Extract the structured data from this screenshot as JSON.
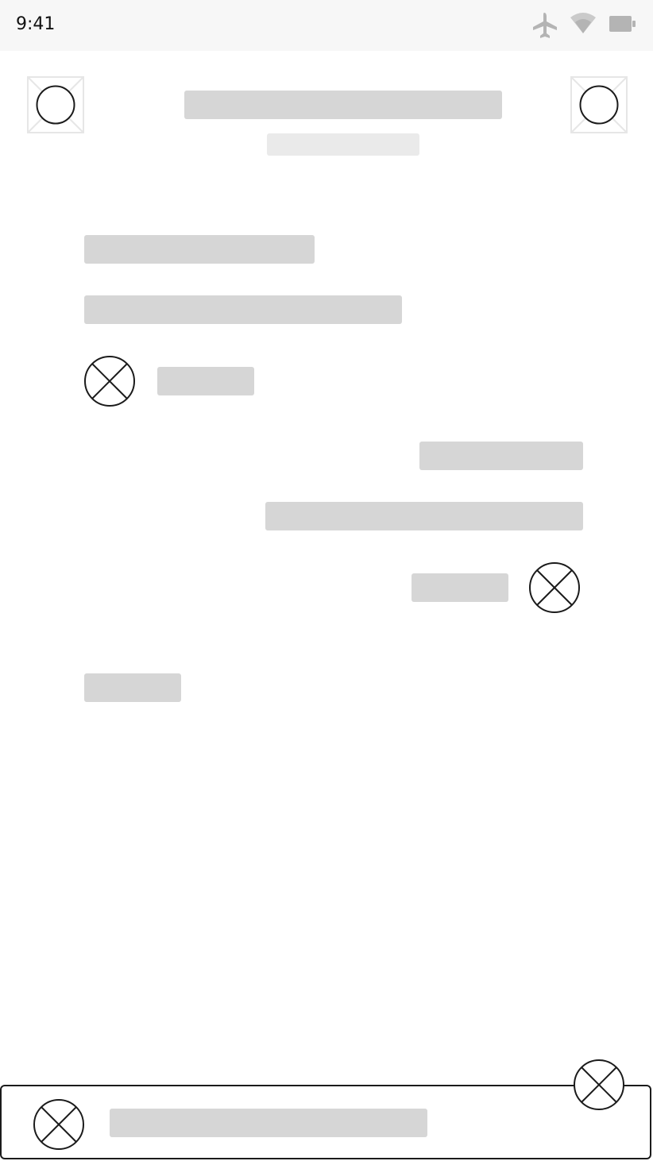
{
  "status_bar": {
    "time": "9:41",
    "icons": [
      "airplane-icon",
      "wifi-icon",
      "battery-icon"
    ]
  },
  "header": {
    "left_icon": "placeholder-image-icon",
    "right_icon": "placeholder-image-icon",
    "title": "",
    "subtitle": ""
  },
  "messages": [
    {
      "side": "left",
      "lines": 2,
      "has_avatar": true,
      "avatar_icon": "avatar-placeholder-icon"
    },
    {
      "side": "right",
      "lines": 2,
      "has_avatar": true,
      "avatar_icon": "avatar-placeholder-icon"
    },
    {
      "side": "left",
      "lines": 1,
      "has_avatar": false
    }
  ],
  "composer": {
    "left_icon": "attachment-placeholder-icon",
    "input_placeholder": "",
    "floating_action_icon": "send-placeholder-icon"
  },
  "colors": {
    "skeleton": "#d6d6d6",
    "skeleton_light": "#eaeaea",
    "icon_stroke": "#1b1b1b",
    "status_bar_bg": "#f7f7f7",
    "status_icon": "#b4b4b4"
  }
}
